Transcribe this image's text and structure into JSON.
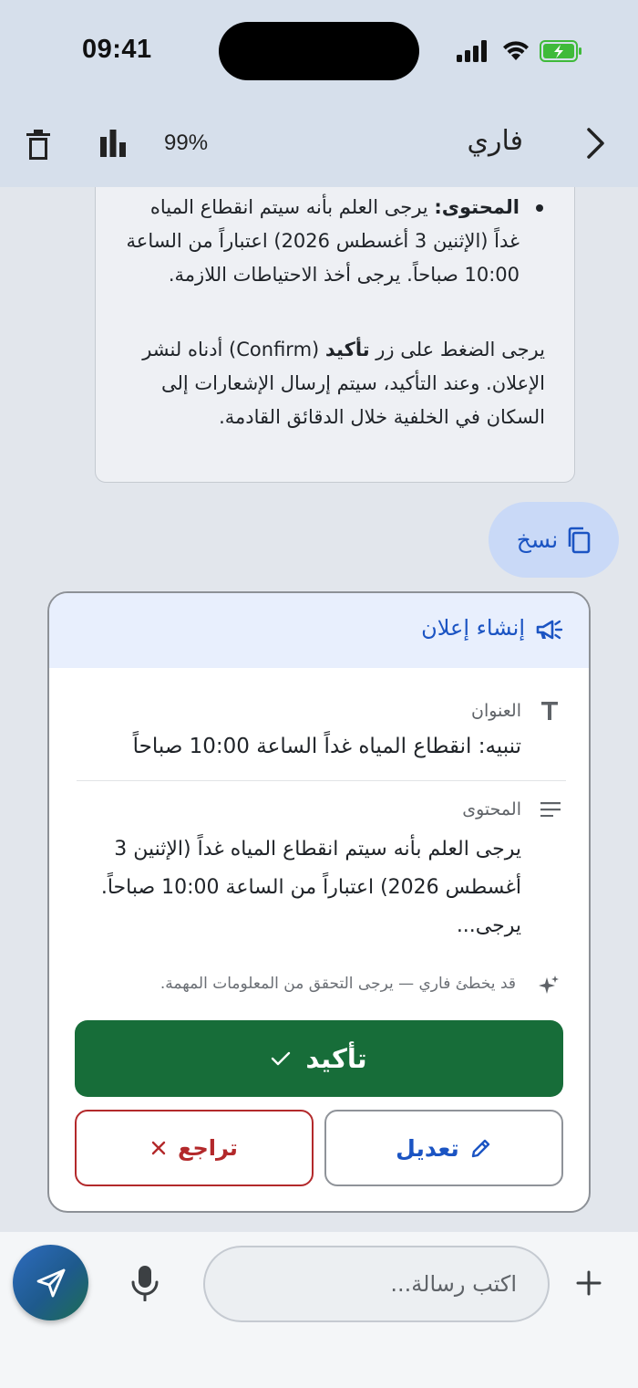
{
  "status_bar": {
    "time": "09:41",
    "icons": [
      "cellular-signal-icon",
      "wifi-icon",
      "battery-charging-icon"
    ],
    "battery_color": "#3fba3a"
  },
  "header": {
    "title": "فاري",
    "percentage": "99%",
    "icons": [
      "trash-icon",
      "bar-chart-icon",
      "chevron-right-icon"
    ]
  },
  "bot_message": {
    "bullet_label": "المحتوى:",
    "bullet_text": " يرجى العلم بأنه سيتم انقطاع المياه غداً (الإثنين 3 أغسطس 2026) اعتباراً من الساعة 10:00 صباحاً. يرجى أخذ الاحتياطات اللازمة.",
    "confirm_prefix": "يرجى الضغط على زر ",
    "confirm_bold": "تأكيد",
    "confirm_suffix": " (Confirm) أدناه لنشر الإعلان. وعند التأكيد، سيتم إرسال الإشعارات إلى السكان في الخلفية خلال الدقائق القادمة."
  },
  "copy_chip": {
    "label": "نسخ",
    "icon": "copy-icon"
  },
  "announcement_card": {
    "title": "إنشاء إعلان",
    "icon": "megaphone-icon",
    "title_field": {
      "label": "العنوان",
      "value": "تنبيه: انقطاع المياه غداً الساعة 10:00 صباحاً",
      "icon": "text-t-icon"
    },
    "content_field": {
      "label": "المحتوى",
      "value": "يرجى العلم بأنه سيتم انقطاع المياه غداً (الإثنين 3 أغسطس 2026) اعتباراً من الساعة 10:00 صباحاً. يرجى...",
      "icon": "lines-icon"
    },
    "disclaimer": "قد يخطئ فاري — يرجى التحقق من المعلومات المهمة.",
    "confirm_label": "تأكيد",
    "edit_label": "تعديل",
    "cancel_label": "تراجع",
    "colors": {
      "accent": "#1b54c3",
      "confirm": "#176d39",
      "cancel": "#b3292b",
      "header_bg": "#e8effd"
    }
  },
  "composer": {
    "placeholder": "اكتب رسالة...",
    "icons": [
      "send-icon",
      "microphone-icon",
      "plus-icon"
    ]
  }
}
